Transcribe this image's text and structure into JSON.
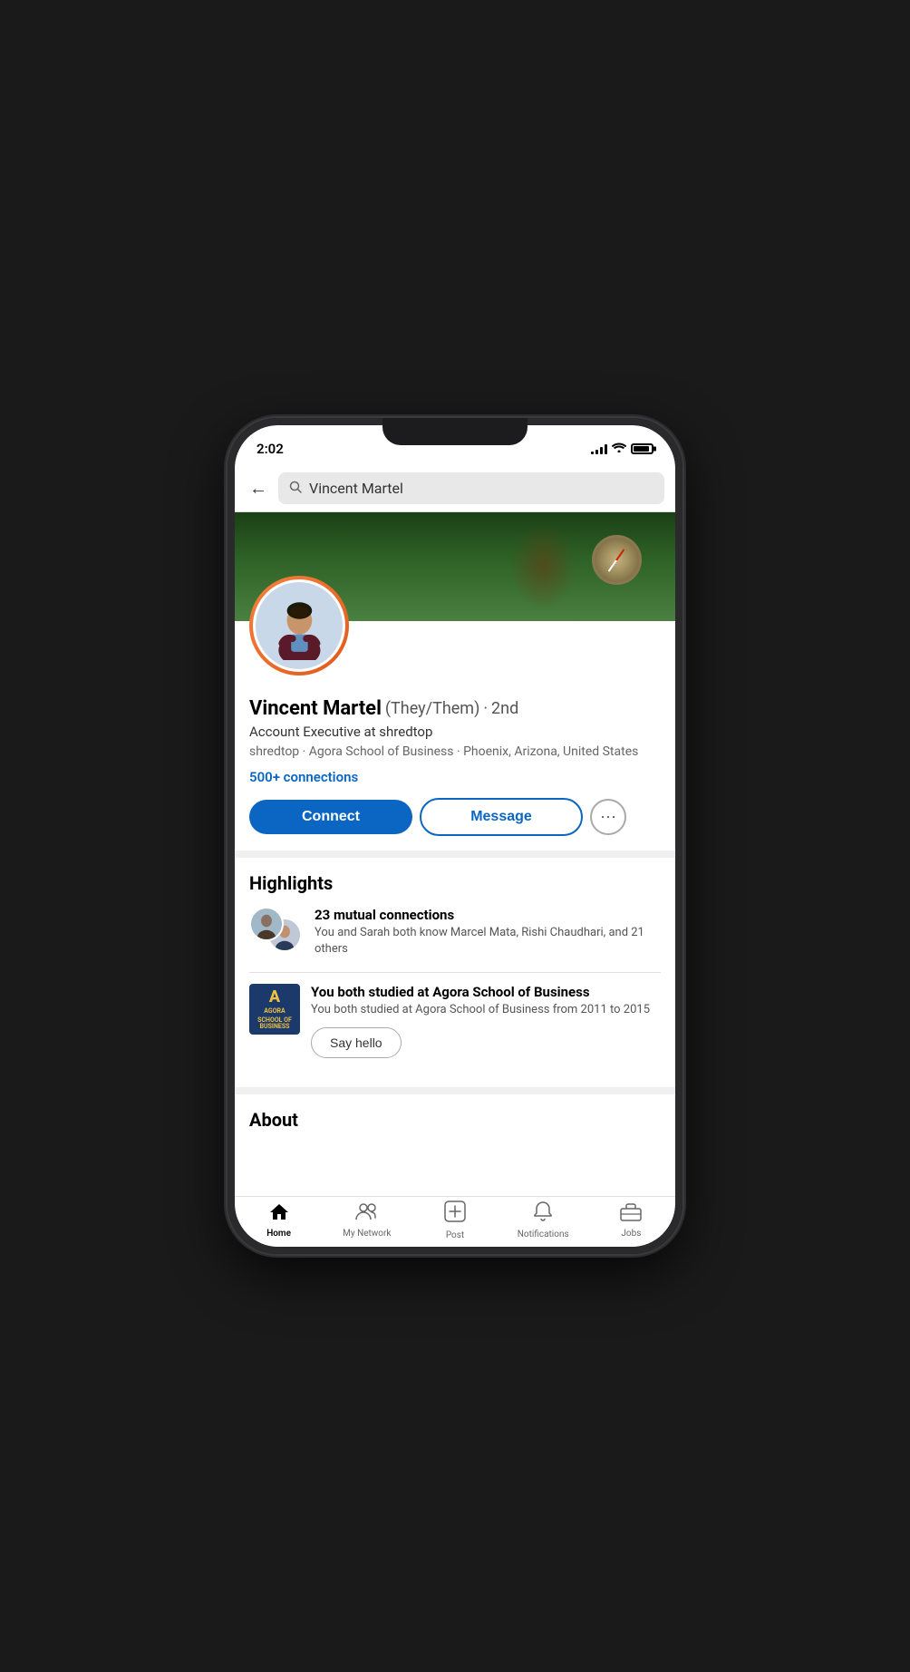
{
  "status": {
    "time": "2:02",
    "signal_bars": [
      3,
      5,
      8,
      11,
      14
    ],
    "battery_level": "90%"
  },
  "search": {
    "query": "Vincent Martel",
    "placeholder": "Search"
  },
  "profile": {
    "name": "Vincent Martel",
    "pronouns": "(They/Them)",
    "degree": "2nd",
    "title": "Account Executive at shredtop",
    "subtitle": "shredtop · Agora School of Business · Phoenix, Arizona, United States",
    "connections": "500+ connections"
  },
  "actions": {
    "connect_label": "Connect",
    "message_label": "Message",
    "more_dots": "···"
  },
  "highlights": {
    "section_title": "Highlights",
    "mutual_connections": {
      "count_label": "23 mutual connections",
      "description": "You and Sarah both know Marcel Mata, Rishi Chaudhari, and 21 others"
    },
    "school": {
      "title": "You both studied at Agora School of Business",
      "description": "You both studied at Agora School of Business from 2011 to 2015",
      "logo_letter": "A",
      "logo_name": "AGORA",
      "logo_subtitle": "SCHOOL OF\nBUSINESS",
      "say_hello": "Say hello"
    }
  },
  "about": {
    "section_title": "About"
  },
  "nav": {
    "items": [
      {
        "label": "Home",
        "icon": "🏠",
        "active": true
      },
      {
        "label": "My Network",
        "icon": "👥",
        "active": false
      },
      {
        "label": "Post",
        "icon": "➕",
        "active": false
      },
      {
        "label": "Notifications",
        "icon": "🔔",
        "active": false
      },
      {
        "label": "Jobs",
        "icon": "💼",
        "active": false
      }
    ]
  }
}
